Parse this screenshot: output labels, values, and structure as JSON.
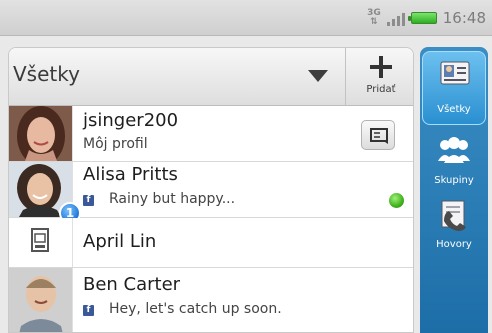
{
  "status_bar": {
    "network_label": "3G",
    "time": "16:48",
    "battery_color": "#2fae22"
  },
  "filter": {
    "selected_label": "Všetky",
    "dropdown_icon": "chevron-down-icon"
  },
  "add_button": {
    "label": "Pridať",
    "icon": "plus-icon"
  },
  "contacts": [
    {
      "name": "jsinger200",
      "subtitle": "Môj profil",
      "action_icon": "contact-card-icon"
    },
    {
      "name": "Alisa Pritts",
      "status": "Rainy but happy...",
      "source_icon": "facebook-icon",
      "badge": "1",
      "presence_color": "#3fb11b"
    },
    {
      "name": "April Lin",
      "avatar_icon": "sim-card-icon"
    },
    {
      "name": "Ben Carter",
      "status": "Hey, let's catch up soon.",
      "source_icon": "facebook-icon"
    }
  ],
  "tabs": [
    {
      "label": "Všetky",
      "icon": "contacts-icon",
      "active": true
    },
    {
      "label": "Skupiny",
      "icon": "groups-icon",
      "active": false
    },
    {
      "label": "Hovory",
      "icon": "call-log-icon",
      "active": false
    }
  ],
  "colors": {
    "accent": "#2a8fd0",
    "facebook": "#3b5998"
  }
}
